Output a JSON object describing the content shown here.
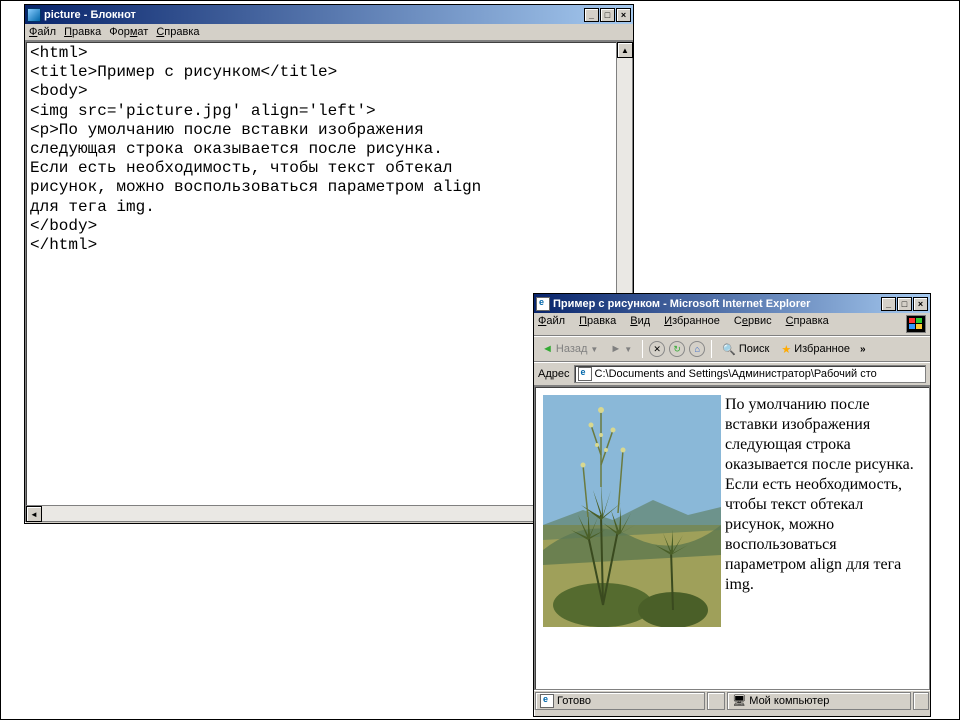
{
  "notepad": {
    "title": "picture - Блокнот",
    "menu": {
      "file": "Файл",
      "edit": "Правка",
      "format": "Формат",
      "help": "Справка"
    },
    "content": "<html>\n<title>Пример с рисунком</title>\n<body>\n<img src='picture.jpg' align='left'>\n<p>По умолчанию после вставки изображения\nследующая строка оказывается после рисунка.\nЕсли есть необходимость, чтобы текст обтекал\nрисунок, можно воспользоваться параметром align\nдля тега img.\n</body>\n</html>"
  },
  "ie": {
    "title": "Пример с рисунком - Microsoft Internet Explorer",
    "menu": {
      "file": "Файл",
      "edit": "Правка",
      "view": "Вид",
      "favorites": "Избранное",
      "tools": "Сервис",
      "help": "Справка"
    },
    "toolbar": {
      "back": "Назад",
      "search": "Поиск",
      "fav": "Избранное"
    },
    "address": {
      "label": "Адрес",
      "value": "C:\\Documents and Settings\\Администратор\\Рабочий сто"
    },
    "page_text": "По умолчанию после вставки изображения следующая строка оказывается после рисунка. Если есть необходимость, чтобы текст обтекал рисунок, можно воспользоваться параметром align для тега img.",
    "status": {
      "ready": "Готово",
      "zone": "Мой компьютер"
    }
  }
}
